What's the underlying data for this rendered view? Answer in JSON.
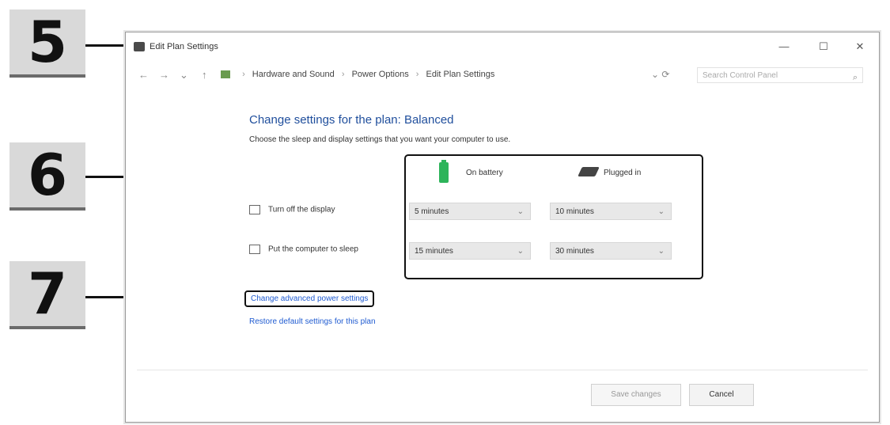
{
  "callouts": [
    {
      "number": "5"
    },
    {
      "number": "6"
    },
    {
      "number": "7"
    }
  ],
  "window": {
    "title": "Edit Plan Settings",
    "controls": {
      "minimize": "—",
      "maximize": "☐",
      "close": "✕"
    }
  },
  "address": {
    "nav": {
      "back": "←",
      "forward": "→",
      "up": "↑"
    },
    "path": [
      "Hardware and Sound",
      "Power Options",
      "Edit Plan Settings"
    ],
    "search_placeholder": "Search Control Panel",
    "icons": {
      "folder": "folder-icon",
      "search": "search-icon",
      "refresh": "refresh-icon"
    }
  },
  "content": {
    "heading": "Change settings for the plan: Balanced",
    "subtext": "Choose the sleep and display settings that you want your computer to use.",
    "columns": {
      "battery": "On battery",
      "plugged": "Plugged in"
    },
    "rows": [
      {
        "label": "Turn off the display",
        "battery_value": "5 minutes",
        "plugged_value": "10 minutes"
      },
      {
        "label": "Put the computer to sleep",
        "battery_value": "15 minutes",
        "plugged_value": "30 minutes"
      }
    ],
    "links": {
      "advanced": "Change advanced power settings",
      "restore": "Restore default settings for this plan"
    },
    "buttons": {
      "save": "Save changes",
      "cancel": "Cancel"
    }
  },
  "colors": {
    "heading": "#1f4e9c",
    "link": "#1f5bd1",
    "battery": "#2db45a"
  }
}
